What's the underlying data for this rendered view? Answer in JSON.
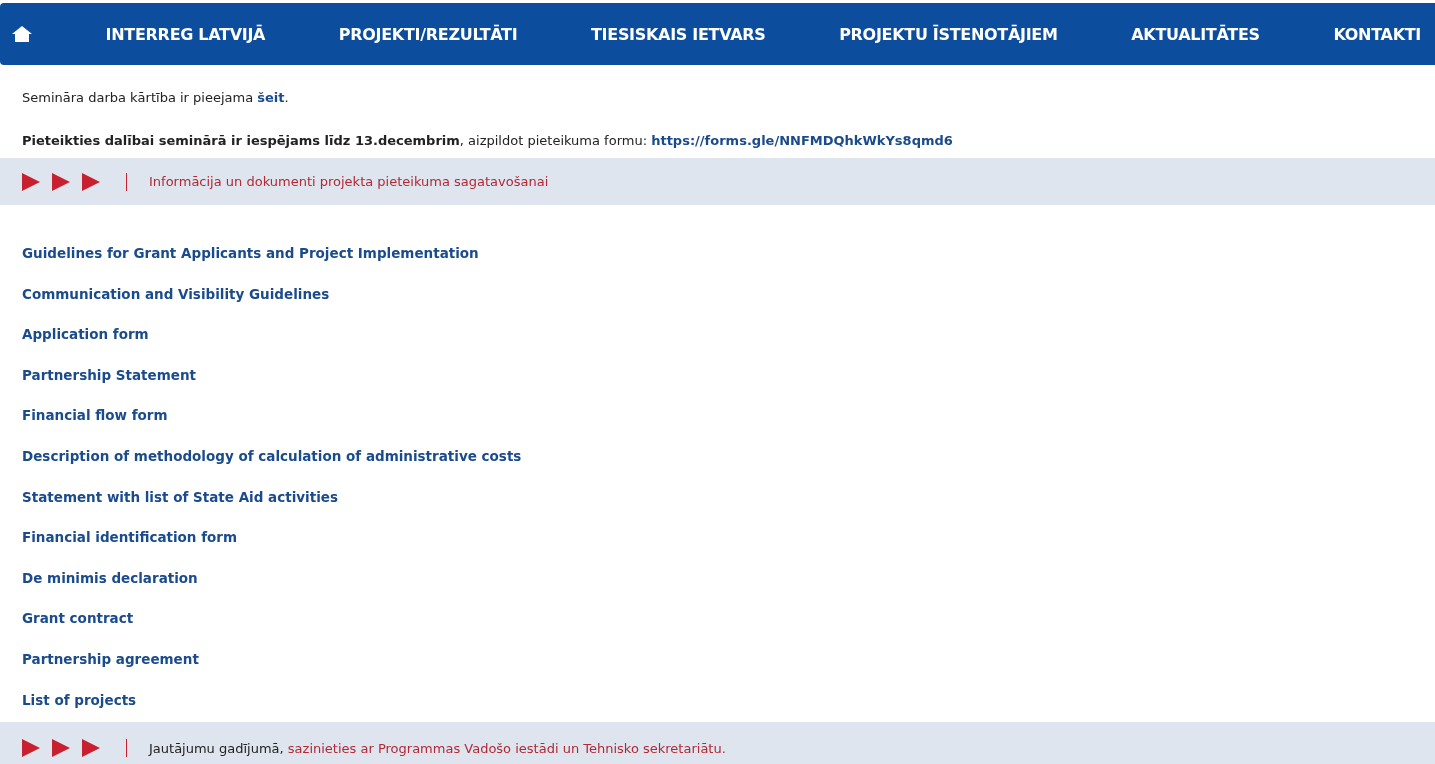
{
  "nav": {
    "items": [
      "INTERREG LATVIJĀ",
      "PROJEKTI/REZULTĀTI",
      "TIESISKAIS IETVARS",
      "PROJEKTU ĪSTENOTĀJIEM",
      "AKTUALITĀTES",
      "KONTAKTI"
    ]
  },
  "intro": [
    {
      "text": "Semināra darba kārtība ir pieejama ",
      "link": "šeit",
      "after": "."
    },
    {
      "text": "**Pieteikties dalībai seminārā ir iespējams līdz 13.decembrim**, aizpildot pieteikuma formu: ",
      "link": "https://forms.gle/NNFMDQhkWkYs8qmd6"
    }
  ],
  "section": {
    "heading": "Informācija un dokumenti projekta pieteikuma sagatavošanai"
  },
  "documents": [
    "Guidelines for Grant Applicants and Project Implementation",
    "Communication and Visibility Guidelines",
    "Application form",
    "Partnership Statement",
    "Financial flow form",
    "Description of methodology of calculation of administrative costs",
    "Statement with list of State Aid activities",
    "Financial identification form",
    "De minimis declaration",
    "Grant contract",
    "Partnership agreement",
    "List of projects"
  ],
  "contact": {
    "text": "Jautājumu gadījumā, ",
    "link": "sazinieties ar Programmas Vadošo iestādi un Tehnisko sekretariātu."
  }
}
